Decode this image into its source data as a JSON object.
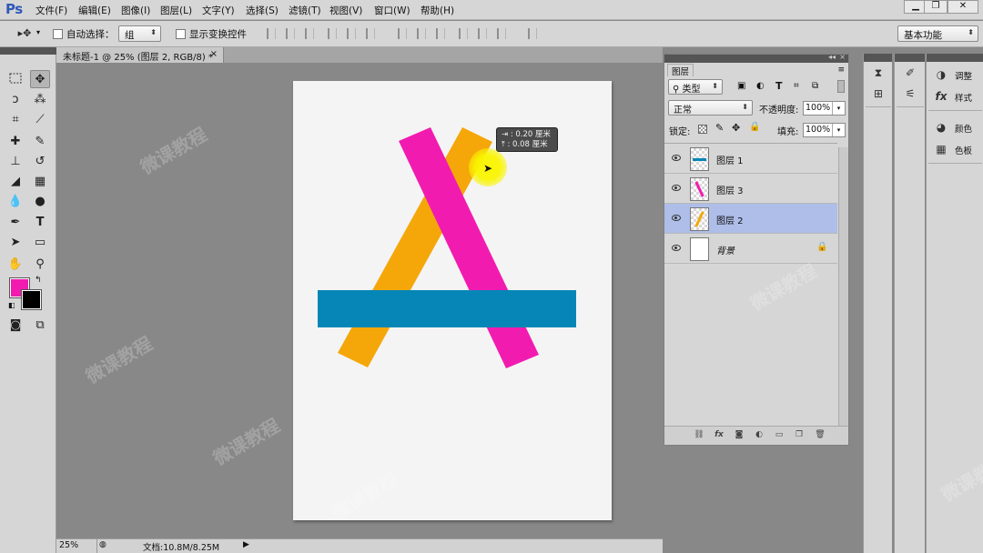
{
  "app": {
    "logo": "Ps"
  },
  "menus": [
    "文件(F)",
    "编辑(E)",
    "图像(I)",
    "图层(L)",
    "文字(Y)",
    "选择(S)",
    "滤镜(T)",
    "视图(V)",
    "窗口(W)",
    "帮助(H)"
  ],
  "options_bar": {
    "auto_select_label": "自动选择：",
    "auto_select_value": "组",
    "show_transform_label": "显示变换控件",
    "workspace_preset": "基本功能"
  },
  "document_tab": {
    "title": "未标题-1 @ 25% (图层 2, RGB/8) *",
    "close": "×"
  },
  "status_bar": {
    "zoom": "25%",
    "doc_info": "文档:10.8M/8.25M"
  },
  "colors": {
    "foreground": "#f21bb0",
    "background": "#000000",
    "pink": "#f21bb0",
    "orange": "#f5a70a",
    "blue": "#0586b6",
    "selection": "#aebee9"
  },
  "measure_hud": {
    "line1": "⇥ : 0.20 厘米",
    "line2": "⤒ : 0.08 厘米"
  },
  "layers_panel": {
    "tab_title": "图层",
    "filter_kind": "类型",
    "blend_mode": "正常",
    "opacity_label": "不透明度:",
    "opacity_value": "100%",
    "lock_label": "锁定:",
    "fill_label": "填充:",
    "fill_value": "100%",
    "layers": [
      {
        "name": "图层 1",
        "selected": false,
        "thumb_color": "#0586b6"
      },
      {
        "name": "图层 3",
        "selected": false,
        "thumb_color": "#f21bb0"
      },
      {
        "name": "图层 2",
        "selected": true,
        "thumb_color": "#f5a70a"
      },
      {
        "name": "背景",
        "selected": false,
        "thumb_color": "#ffffff",
        "locked": true
      }
    ]
  },
  "right_dock": {
    "adjust_label": "调整",
    "styles_label": "样式",
    "color_label": "颜色",
    "swatches_label": "色板"
  },
  "watermark_text": "微课教程"
}
